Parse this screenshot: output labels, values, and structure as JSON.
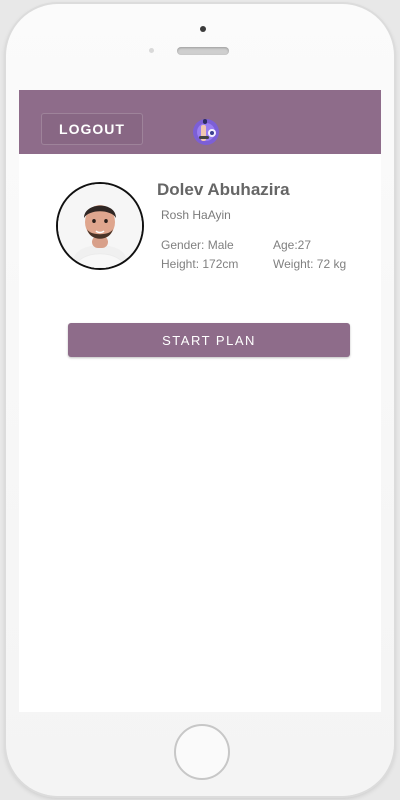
{
  "appbar": {
    "logout_label": "LOGOUT",
    "color": "#8e6c8a"
  },
  "profile": {
    "name": "Dolev Abuhazira",
    "city": "Rosh HaAyin",
    "gender": "Gender: Male",
    "age": "Age:27",
    "height": "Height: 172cm",
    "weight": "Weight: 72  kg"
  },
  "actions": {
    "start_label": "START PLAN"
  },
  "icons": {
    "logo": "fitness-logo-icon",
    "avatar": "user-avatar"
  }
}
